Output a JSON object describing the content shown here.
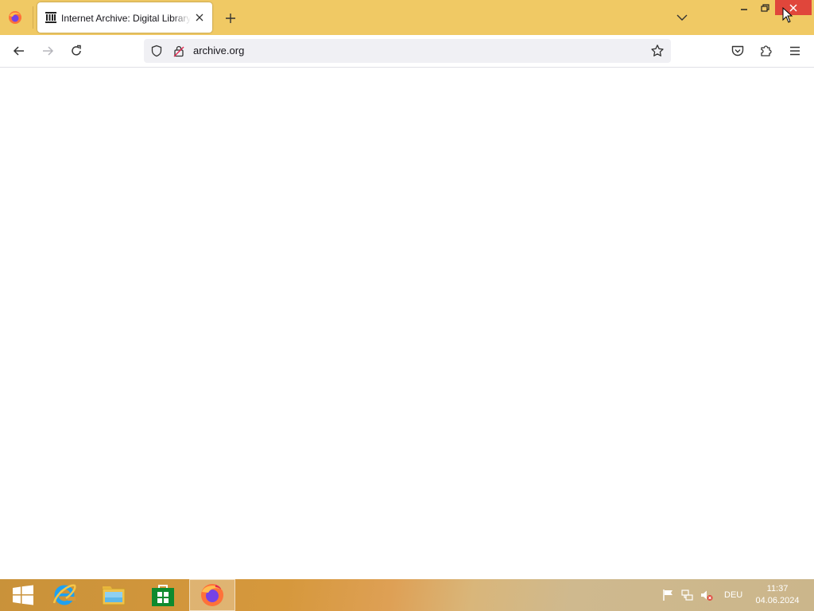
{
  "browser": {
    "tab": {
      "title": "Internet Archive: Digital Library of Free & Borrowable Books, Movies, Music & Wayback Machine",
      "favicon": "archive-building-icon"
    },
    "urlbar": {
      "url": "archive.org"
    }
  },
  "taskbar": {
    "apps": [
      "start-button",
      "internet-explorer-icon",
      "file-explorer-icon",
      "windows-store-icon",
      "firefox-icon"
    ],
    "active_app": "firefox-icon",
    "tray": {
      "language": "DEU",
      "time": "11:37",
      "date": "04.06.2024"
    }
  },
  "colors": {
    "titlebar": "#f0c964",
    "window_close_hover": "#e0463b",
    "urlbar_bg": "#f0f0f4"
  }
}
